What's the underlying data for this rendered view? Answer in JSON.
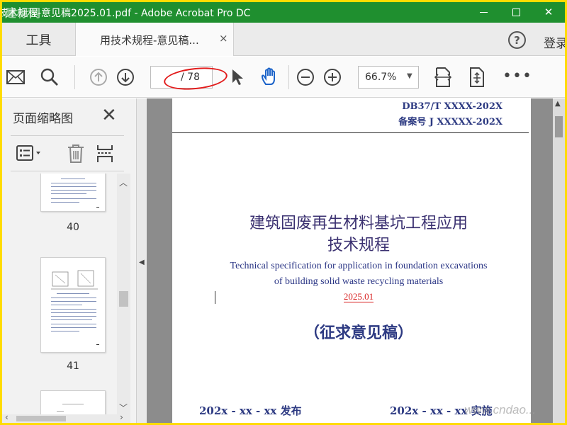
{
  "window": {
    "title": "技术规程-意见稿2025.01.pdf - Adobe Acrobat Pro DC",
    "watermark": "建标网"
  },
  "tabs": {
    "tools_label": "工具",
    "doc_tab_label": "用技术规程-意见稿...",
    "close_glyph": "×",
    "help_glyph": "?",
    "login_label": "登录"
  },
  "toolbar": {
    "page_input": "",
    "page_total": "/ 78",
    "zoom_value": "66.7%",
    "zoom_caret": "▼",
    "more_glyph": "•••",
    "annotation_color": "#e21b1b"
  },
  "sidepanel": {
    "title": "页面缩略图",
    "close_glyph": "✕",
    "thumbnails": [
      {
        "page_label": "40"
      },
      {
        "page_label": "41"
      },
      {
        "page_label": ""
      }
    ]
  },
  "document": {
    "std_code": "DB37/T  XXXX-202X",
    "record_no": "备案号 J XXXXX-202X",
    "cn_title_line1": "建筑固废再生材料基坑工程应用",
    "cn_title_line2": "技术规程",
    "en_title_line1": "Technical specification for application in foundation excavations",
    "en_title_line2": "of building solid waste recycling materials",
    "version_date": "2025.01",
    "draft_label": "（征求意见稿）",
    "publish_label": "202x - xx - xx    发布",
    "implement_label": "202x - xx - xx    实施",
    "text_color": "#2d3a82",
    "date_color": "#d71f1f"
  },
  "overlay": {
    "watermark_url": "www.cndao..."
  }
}
